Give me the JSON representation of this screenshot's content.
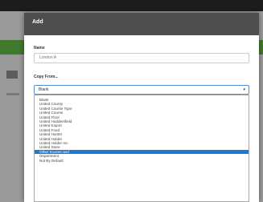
{
  "modal": {
    "title": "Add",
    "name_label": "Name",
    "name_value": "London A",
    "copy_label": "Copy From...",
    "select_value": "Blank"
  },
  "options": [
    "Blank",
    "United County",
    "United Course Type",
    "United Course",
    "United Floor",
    "United Huddersfield",
    "United Export",
    "United Food",
    "United Hunter",
    "United Holder",
    "United Holder Inc",
    "United Store",
    "Other Income and",
    "Department",
    "Not By Default"
  ],
  "selected_index": 12
}
